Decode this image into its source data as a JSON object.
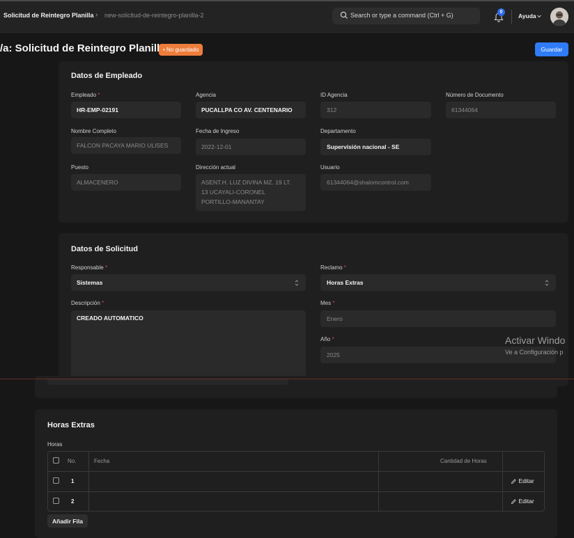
{
  "navbar": {
    "breadcrumb_parent": "Solicitud de Reintegro Planilla",
    "breadcrumb_separator": "›",
    "breadcrumb_current": "new-solicitud-de-reintegro-planilla-2",
    "search_placeholder": "Search or type a command (Ctrl + G)",
    "notification_count": "0",
    "help_label": "Ayuda"
  },
  "header": {
    "title": "/a: Solicitud de Reintegro Planilla",
    "status_badge": "• No guardado",
    "save_label": "Guardar"
  },
  "empleado": {
    "section_title": "Datos de Empleado",
    "empleado_label": "Empleado",
    "empleado_value": "HR-EMP-02191",
    "agencia_label": "Agencia",
    "agencia_value": "PUCALLPA CO AV. CENTENARIO",
    "id_agencia_label": "ID Agencia",
    "id_agencia_value": "312",
    "num_doc_label": "Número de Documento",
    "num_doc_value": "61344064",
    "nombre_label": "Nombre Completo",
    "nombre_value": "FALCON PACAYA MARIO ULISES",
    "fecha_ingreso_label": "Fecha de Ingreso",
    "fecha_ingreso_value": "2022-12-01",
    "departamento_label": "Departamento",
    "departamento_value": "Supervisión nacional - SE",
    "puesto_label": "Puesto",
    "puesto_value": "ALMACENERO",
    "direccion_label": "Dirección actual",
    "direccion_line1": "ASENT.H. LUZ DIVINA MZ. 19 LT.",
    "direccion_line2": "13 UCAYALI-CORONEL",
    "direccion_line3": "PORTILLO-MANANTAY",
    "usuario_label": "Usuario",
    "usuario_value": "61344064@shalomcontrol.com"
  },
  "solicitud": {
    "section_title": "Datos de Solicitud",
    "responsable_label": "Responsable",
    "responsable_value": "Sistemas",
    "reclamo_label": "Reclamo",
    "reclamo_value": "Horas Extras",
    "descripcion_label": "Descripción",
    "descripcion_value": "CREADO AUTOMATICO",
    "mes_label": "Mes",
    "mes_value": "Enero",
    "anio_label": "Año",
    "anio_value": "2025",
    "required_mark": "*"
  },
  "watermark": {
    "line1": "Activar Windo",
    "line2": "Ve a Configuración p"
  },
  "horas_extras": {
    "section_title": "Horas Extras",
    "table_label": "Horas",
    "col_no": "No.",
    "col_fecha": "Fecha",
    "col_cantidad": "Cantidad de Horas",
    "rows": [
      {
        "no": "1",
        "fecha": "",
        "cantidad": "",
        "action": "Editar"
      },
      {
        "no": "2",
        "fecha": "",
        "cantidad": "",
        "action": "Editar"
      }
    ],
    "add_row_label": "Añadir Fila"
  }
}
